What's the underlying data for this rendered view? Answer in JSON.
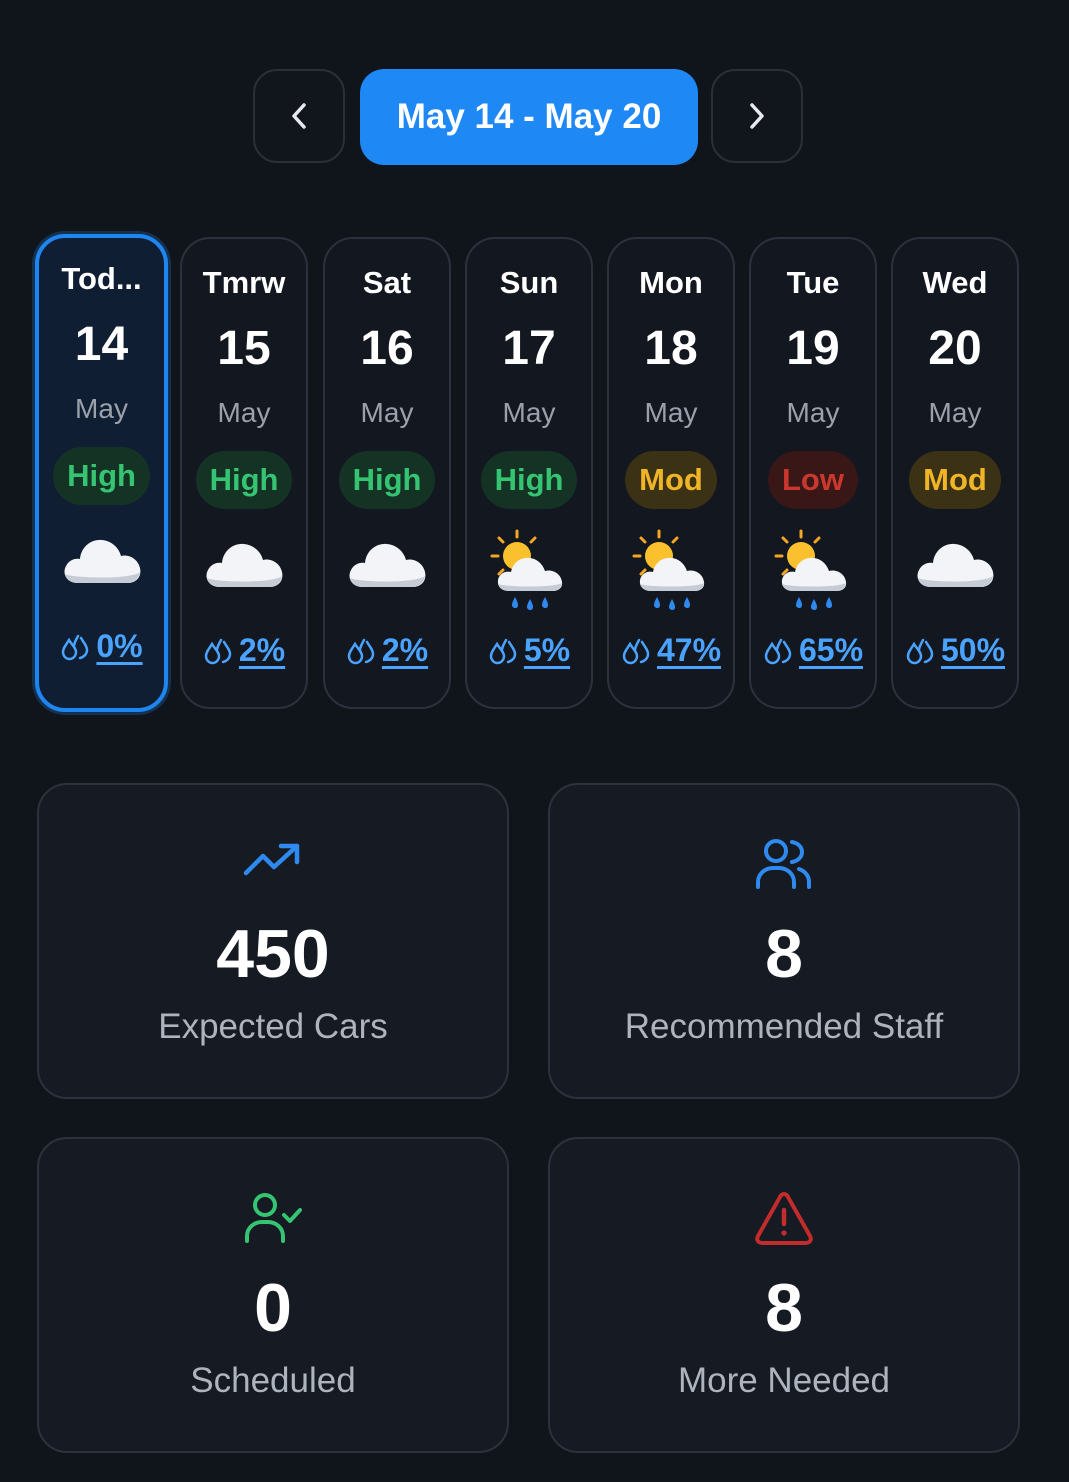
{
  "week_nav": {
    "range_label": "May 14 - May 20",
    "prev_icon": "chevron-left-icon",
    "next_icon": "chevron-right-icon"
  },
  "days": [
    {
      "name": "Tod...",
      "date": "14",
      "month": "May",
      "level": "High",
      "weather": "cloud",
      "rain": "0%",
      "selected": true
    },
    {
      "name": "Tmrw",
      "date": "15",
      "month": "May",
      "level": "High",
      "weather": "cloud",
      "rain": "2%"
    },
    {
      "name": "Sat",
      "date": "16",
      "month": "May",
      "level": "High",
      "weather": "cloud",
      "rain": "2%"
    },
    {
      "name": "Sun",
      "date": "17",
      "month": "May",
      "level": "High",
      "weather": "sun-behind-rain-cloud",
      "rain": "5%"
    },
    {
      "name": "Mon",
      "date": "18",
      "month": "May",
      "level": "Mod",
      "weather": "sun-behind-rain-cloud",
      "rain": "47%"
    },
    {
      "name": "Tue",
      "date": "19",
      "month": "May",
      "level": "Low",
      "weather": "sun-behind-rain-cloud",
      "rain": "65%"
    },
    {
      "name": "Wed",
      "date": "20",
      "month": "May",
      "level": "Mod",
      "weather": "cloud",
      "rain": "50%"
    }
  ],
  "stats": {
    "expected_cars": {
      "value": "450",
      "label": "Expected Cars",
      "icon": "trending-up-icon",
      "color": "#2f8af0"
    },
    "recommended_staff": {
      "value": "8",
      "label": "Recommended Staff",
      "icon": "users-icon",
      "color": "#2f8af0"
    },
    "scheduled": {
      "value": "0",
      "label": "Scheduled",
      "icon": "user-check-icon",
      "color": "#35c472"
    },
    "more_needed": {
      "value": "8",
      "label": "More Needed",
      "icon": "alert-triangle-icon",
      "color": "#c42b2b"
    }
  },
  "colors": {
    "accent": "#1e88f5",
    "background": "#10141b",
    "level_high": "#35c472",
    "level_mod": "#f0b526",
    "level_low": "#c9372d",
    "rain": "#4aa3ff"
  }
}
